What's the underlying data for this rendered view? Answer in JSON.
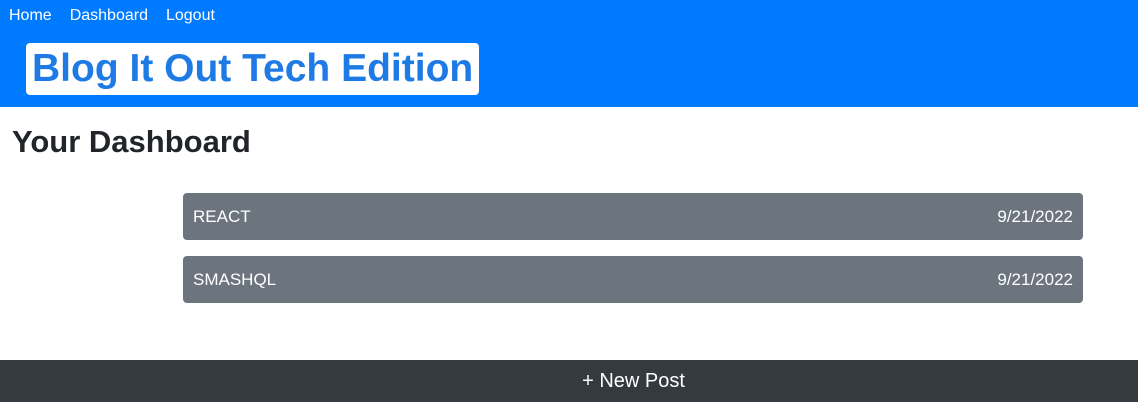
{
  "nav": {
    "items": [
      {
        "label": "Home"
      },
      {
        "label": "Dashboard"
      },
      {
        "label": "Logout"
      }
    ]
  },
  "header": {
    "site_title": "Blog It Out Tech Edition"
  },
  "main": {
    "page_title": "Your Dashboard",
    "posts": [
      {
        "title": "REACT",
        "date": "9/21/2022"
      },
      {
        "title": "SMASHQL",
        "date": "9/21/2022"
      }
    ]
  },
  "footer": {
    "new_post_label": "+ New Post"
  },
  "colors": {
    "header_bg": "#007bff",
    "title_text": "#1e7be6",
    "post_card_bg": "#6c757d",
    "footer_bg": "#343a40"
  }
}
